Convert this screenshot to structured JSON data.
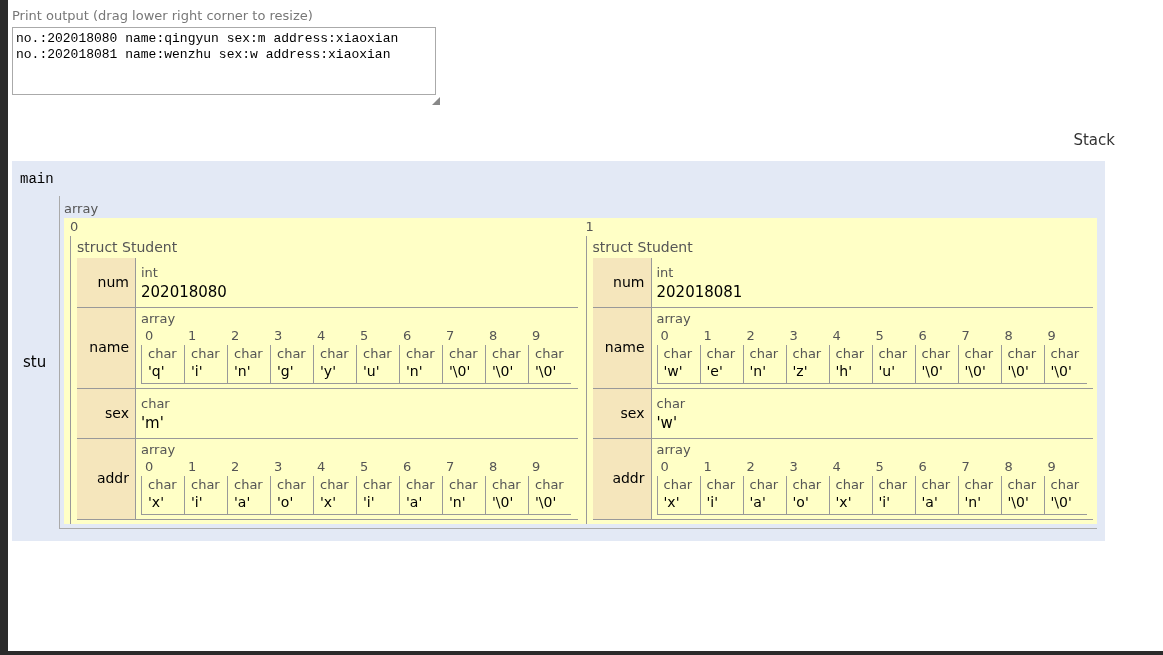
{
  "print_output": {
    "label": "Print output (drag lower right corner to resize)",
    "lines": [
      "no.:202018080 name:qingyun sex:m address:xiaoxian",
      "no.:202018081 name:wenzhu sex:w address:xiaoxian"
    ]
  },
  "stack_heading": "Stack",
  "frame": {
    "name": "main",
    "variables": [
      {
        "name": "stu",
        "type": "array",
        "elements": [
          {
            "index": "0",
            "type": "struct Student",
            "fields": [
              {
                "name": "num",
                "kind": "scalar",
                "type": "int",
                "value": "202018080"
              },
              {
                "name": "name",
                "kind": "array",
                "type": "array",
                "elements": [
                  {
                    "index": "0",
                    "type": "char",
                    "value": "'q'"
                  },
                  {
                    "index": "1",
                    "type": "char",
                    "value": "'i'"
                  },
                  {
                    "index": "2",
                    "type": "char",
                    "value": "'n'"
                  },
                  {
                    "index": "3",
                    "type": "char",
                    "value": "'g'"
                  },
                  {
                    "index": "4",
                    "type": "char",
                    "value": "'y'"
                  },
                  {
                    "index": "5",
                    "type": "char",
                    "value": "'u'"
                  },
                  {
                    "index": "6",
                    "type": "char",
                    "value": "'n'"
                  },
                  {
                    "index": "7",
                    "type": "char",
                    "value": "'\\0'"
                  },
                  {
                    "index": "8",
                    "type": "char",
                    "value": "'\\0'"
                  },
                  {
                    "index": "9",
                    "type": "char",
                    "value": "'\\0'"
                  }
                ]
              },
              {
                "name": "sex",
                "kind": "scalar",
                "type": "char",
                "value": "'m'"
              },
              {
                "name": "addr",
                "kind": "array",
                "type": "array",
                "elements": [
                  {
                    "index": "0",
                    "type": "char",
                    "value": "'x'"
                  },
                  {
                    "index": "1",
                    "type": "char",
                    "value": "'i'"
                  },
                  {
                    "index": "2",
                    "type": "char",
                    "value": "'a'"
                  },
                  {
                    "index": "3",
                    "type": "char",
                    "value": "'o'"
                  },
                  {
                    "index": "4",
                    "type": "char",
                    "value": "'x'"
                  },
                  {
                    "index": "5",
                    "type": "char",
                    "value": "'i'"
                  },
                  {
                    "index": "6",
                    "type": "char",
                    "value": "'a'"
                  },
                  {
                    "index": "7",
                    "type": "char",
                    "value": "'n'"
                  },
                  {
                    "index": "8",
                    "type": "char",
                    "value": "'\\0'"
                  },
                  {
                    "index": "9",
                    "type": "char",
                    "value": "'\\0'"
                  }
                ]
              }
            ]
          },
          {
            "index": "1",
            "type": "struct Student",
            "fields": [
              {
                "name": "num",
                "kind": "scalar",
                "type": "int",
                "value": "202018081"
              },
              {
                "name": "name",
                "kind": "array",
                "type": "array",
                "elements": [
                  {
                    "index": "0",
                    "type": "char",
                    "value": "'w'"
                  },
                  {
                    "index": "1",
                    "type": "char",
                    "value": "'e'"
                  },
                  {
                    "index": "2",
                    "type": "char",
                    "value": "'n'"
                  },
                  {
                    "index": "3",
                    "type": "char",
                    "value": "'z'"
                  },
                  {
                    "index": "4",
                    "type": "char",
                    "value": "'h'"
                  },
                  {
                    "index": "5",
                    "type": "char",
                    "value": "'u'"
                  },
                  {
                    "index": "6",
                    "type": "char",
                    "value": "'\\0'"
                  },
                  {
                    "index": "7",
                    "type": "char",
                    "value": "'\\0'"
                  },
                  {
                    "index": "8",
                    "type": "char",
                    "value": "'\\0'"
                  },
                  {
                    "index": "9",
                    "type": "char",
                    "value": "'\\0'"
                  }
                ]
              },
              {
                "name": "sex",
                "kind": "scalar",
                "type": "char",
                "value": "'w'"
              },
              {
                "name": "addr",
                "kind": "array",
                "type": "array",
                "elements": [
                  {
                    "index": "0",
                    "type": "char",
                    "value": "'x'"
                  },
                  {
                    "index": "1",
                    "type": "char",
                    "value": "'i'"
                  },
                  {
                    "index": "2",
                    "type": "char",
                    "value": "'a'"
                  },
                  {
                    "index": "3",
                    "type": "char",
                    "value": "'o'"
                  },
                  {
                    "index": "4",
                    "type": "char",
                    "value": "'x'"
                  },
                  {
                    "index": "5",
                    "type": "char",
                    "value": "'i'"
                  },
                  {
                    "index": "6",
                    "type": "char",
                    "value": "'a'"
                  },
                  {
                    "index": "7",
                    "type": "char",
                    "value": "'n'"
                  },
                  {
                    "index": "8",
                    "type": "char",
                    "value": "'\\0'"
                  },
                  {
                    "index": "9",
                    "type": "char",
                    "value": "'\\0'"
                  }
                ]
              }
            ]
          }
        ]
      }
    ]
  }
}
